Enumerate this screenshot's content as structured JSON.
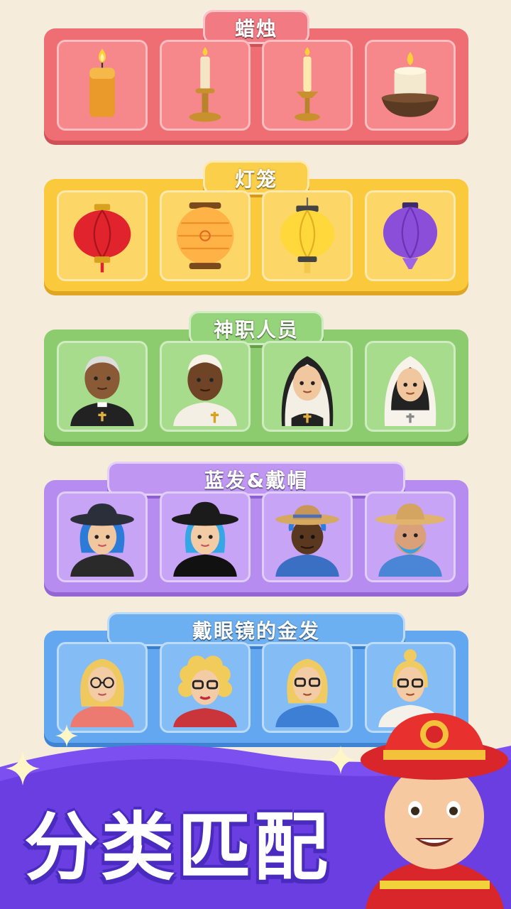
{
  "groups": [
    {
      "label": "蜡烛",
      "items": [
        "pillar-candle",
        "brass-candlestick",
        "tall-candle-holder",
        "candle-in-bowl"
      ]
    },
    {
      "label": "灯笼",
      "items": [
        "red-lantern",
        "orange-paper-lantern",
        "yellow-lantern",
        "purple-lantern"
      ]
    },
    {
      "label": "神职人员",
      "items": [
        "priest",
        "pope",
        "nun-black-habit",
        "nun-white-habit"
      ]
    },
    {
      "label": "蓝发&戴帽",
      "items": [
        "blue-hair-woman-leather-jacket",
        "blue-hair-woman-turtleneck",
        "blue-hair-man-straw-hat",
        "blue-beard-man-straw-hat"
      ]
    },
    {
      "label": "戴眼镜的金发",
      "items": [
        "blonde-woman-glasses-pink",
        "blonde-curly-woman-glasses",
        "blonde-woman-glasses-blue-shirt",
        "blonde-bun-woman-glasses"
      ]
    }
  ],
  "banner": {
    "headline": "分类匹配",
    "mascot": "firefighter-mascot"
  },
  "colors": {
    "candles": "#ee6e74",
    "lanterns": "#fbc93c",
    "clergy": "#8ccc6e",
    "hats": "#b78cf0",
    "glasses": "#62a7ef",
    "banner": "#7b4ff0"
  }
}
